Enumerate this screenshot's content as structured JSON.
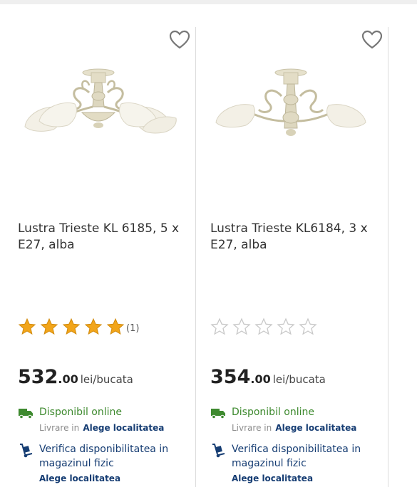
{
  "colors": {
    "brand_blue": "#163d73",
    "available_green": "#3e8a2f",
    "star_filled": "#f2a51a",
    "star_empty": "#c8c8c8"
  },
  "products": [
    {
      "title": "Lustra Trieste KL 6185, 5 x E27, alba",
      "rating": 5,
      "review_count": "(1)",
      "price_int": "532",
      "price_dec": ".00",
      "price_unit": "lei/bucata",
      "available_online": "Disponibil online",
      "delivery_prefix": "Livrare in",
      "choose_location": "Alege localitatea",
      "check_store": "Verifica disponibilitatea in magazinul fizic",
      "check_store_location": "Alege localitatea",
      "wishlist_icon": "heart-outline-icon",
      "delivery_icon": "truck-icon",
      "store_icon": "hand-truck-icon"
    },
    {
      "title": "Lustra Trieste KL6184, 3 x E27, alba",
      "rating": 0,
      "review_count": "",
      "price_int": "354",
      "price_dec": ".00",
      "price_unit": "lei/bucata",
      "available_online": "Disponibil online",
      "delivery_prefix": "Livrare in",
      "choose_location": "Alege localitatea",
      "check_store": "Verifica disponibilitatea in magazinul fizic",
      "check_store_location": "Alege localitatea",
      "wishlist_icon": "heart-outline-icon",
      "delivery_icon": "truck-icon",
      "store_icon": "hand-truck-icon"
    }
  ]
}
